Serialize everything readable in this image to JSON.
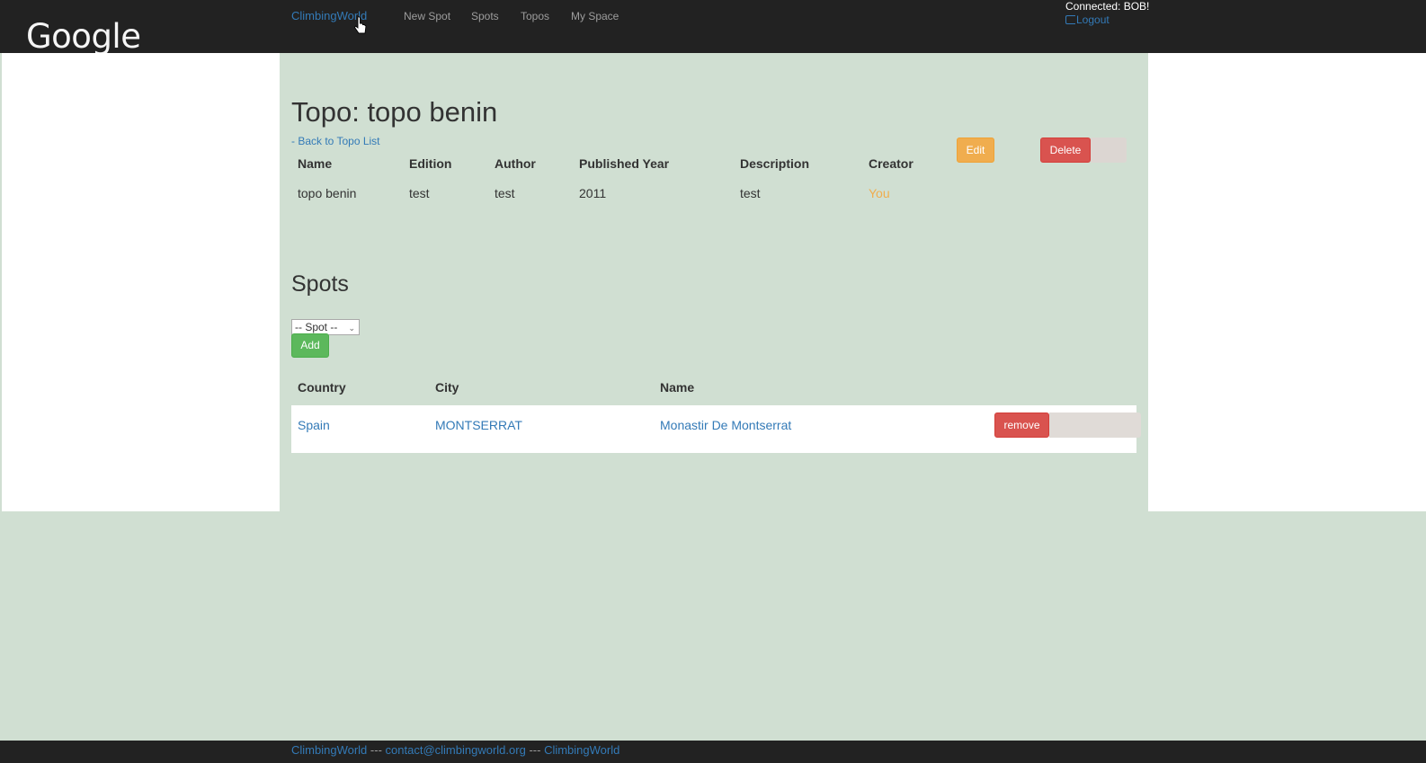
{
  "navbar": {
    "logo": "Google",
    "brand": "ClimbingWorld",
    "links": [
      "New Spot",
      "Spots",
      "Topos",
      "My Space"
    ],
    "connected": "Connected: BOB!",
    "logout": "Logout"
  },
  "topo": {
    "title": "Topo: topo benin",
    "back_link": "- Back to Topo List",
    "headers": [
      "Name",
      "Edition",
      "Author",
      "Published Year",
      "Description",
      "Creator"
    ],
    "row": {
      "name": "topo benin",
      "edition": "test",
      "author": "test",
      "published_year": "2011",
      "description": "test",
      "creator": "You"
    },
    "edit_label": "Edit",
    "delete_label": "Delete"
  },
  "spots": {
    "title": "Spots",
    "select_value": "-- Spot --",
    "add_label": "Add",
    "headers": [
      "Country",
      "City",
      "Name"
    ],
    "rows": [
      {
        "country": "Spain",
        "city": "MONTSERRAT",
        "name": "Monastir De Montserrat",
        "remove_label": "remove"
      }
    ]
  },
  "footer": {
    "brand": "ClimbingWorld",
    "sep1": "---",
    "email": "contact@climbingworld.org",
    "sep2": "---",
    "brand2": "ClimbingWorld"
  },
  "colors": {
    "navbar_bg": "#222222",
    "page_bg": "#d0dfd2",
    "link": "#337ab7",
    "warning": "#f0ad4e",
    "danger": "#d9534f",
    "success": "#5cb85c"
  }
}
